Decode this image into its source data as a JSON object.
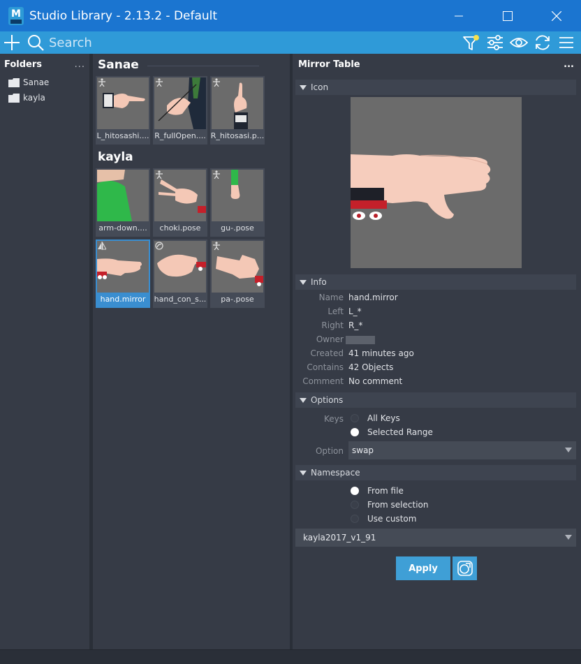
{
  "window": {
    "title": "Studio Library - 2.13.2 - Default",
    "app_icon_letter": "M"
  },
  "toolbar": {
    "search_placeholder": "Search"
  },
  "folders": {
    "title": "Folders",
    "menu": "...",
    "items": [
      {
        "label": "Sanae"
      },
      {
        "label": "kayla"
      }
    ]
  },
  "library": {
    "groups": [
      {
        "title": "Sanae",
        "items": [
          {
            "label": "L_hitosashi....",
            "type": "pose"
          },
          {
            "label": "R_fullOpen....",
            "type": "pose"
          },
          {
            "label": "R_hitosasi.p...",
            "type": "pose"
          }
        ]
      },
      {
        "title": "kayla",
        "items": [
          {
            "label": "arm-down....",
            "type": "pose"
          },
          {
            "label": "choki.pose",
            "type": "pose"
          },
          {
            "label": "gu-.pose",
            "type": "pose"
          },
          {
            "label": "hand.mirror",
            "type": "mirror",
            "selected": true
          },
          {
            "label": "hand_con_s...",
            "type": "selection"
          },
          {
            "label": "pa-.pose",
            "type": "pose"
          }
        ]
      }
    ]
  },
  "details": {
    "title": "Mirror Table",
    "menu": "...",
    "sections": {
      "icon": "Icon",
      "info": "Info",
      "options": "Options",
      "namespace": "Namespace"
    },
    "info": [
      {
        "key": "Name",
        "value": "hand.mirror"
      },
      {
        "key": "Left",
        "value": "L_*"
      },
      {
        "key": "Right",
        "value": "R_*"
      },
      {
        "key": "Owner",
        "value": ""
      },
      {
        "key": "Created",
        "value": "41 minutes ago"
      },
      {
        "key": "Contains",
        "value": "42 Objects"
      },
      {
        "key": "Comment",
        "value": "No comment"
      }
    ],
    "options": {
      "keys_label": "Keys",
      "keys_choices": [
        {
          "label": "All Keys",
          "checked": false
        },
        {
          "label": "Selected Range",
          "checked": true
        }
      ],
      "option_label": "Option",
      "option_value": "swap"
    },
    "namespace": {
      "choices": [
        {
          "label": "From file",
          "checked": true
        },
        {
          "label": "From selection",
          "checked": false
        },
        {
          "label": "Use custom",
          "checked": false
        }
      ],
      "value": "kayla2017_v1_91"
    },
    "apply_label": "Apply"
  },
  "colors": {
    "titlebar": "#1b75d0",
    "toolbar": "#2f9ad8",
    "panel": "#363b46",
    "accent": "#3f9fd6",
    "filter_dot": "#f4e04d"
  }
}
